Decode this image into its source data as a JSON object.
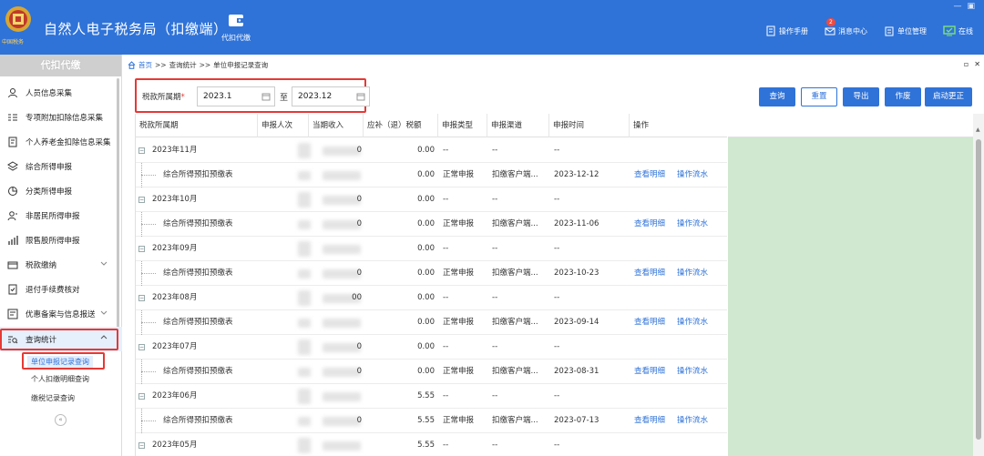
{
  "app": {
    "title": "自然人电子税务局（扣缴端）",
    "emblem_text": "中国税务",
    "module_label": "代扣代缴",
    "window_controls": [
      "—",
      "▣"
    ]
  },
  "top_right": {
    "manual": "操作手册",
    "messages": "消息中心",
    "message_count": "2",
    "unit_mgmt": "单位管理",
    "status": "在线"
  },
  "sidebar": {
    "header": "代扣代缴",
    "items": [
      {
        "label": "人员信息采集",
        "icon": "person-icon"
      },
      {
        "label": "专项附加扣除信息采集",
        "icon": "list-icon"
      },
      {
        "label": "个人养老金扣除信息采集",
        "icon": "document-icon"
      },
      {
        "label": "综合所得申报",
        "icon": "layers-icon"
      },
      {
        "label": "分类所得申报",
        "icon": "pie-icon"
      },
      {
        "label": "非居民所得申报",
        "icon": "person-outline-icon"
      },
      {
        "label": "限售股所得申报",
        "icon": "bar-chart-icon"
      },
      {
        "label": "税款缴纳",
        "icon": "wallet-icon"
      },
      {
        "label": "退付手续费核对",
        "icon": "check-doc-icon"
      },
      {
        "label": "优惠备案与信息报送",
        "icon": "report-icon"
      },
      {
        "label": "查询统计",
        "icon": "query-icon"
      }
    ],
    "sub_items": [
      "单位申报记录查询",
      "个人扣缴明细查询",
      "缴税记录查询"
    ],
    "collapse": "«"
  },
  "breadcrumb": {
    "home": "首页",
    "sep": ">>",
    "level1": "查询统计",
    "level2": "单位申报记录查询"
  },
  "filter": {
    "label": "税款所属期",
    "required_mark": "*",
    "start": "2023.1",
    "to": "至",
    "end": "2023.12"
  },
  "buttons": {
    "query": "查询",
    "reset": "重置",
    "export": "导出",
    "void": "作废",
    "correct": "启动更正"
  },
  "table": {
    "headers": [
      "税款所属期",
      "申报人次",
      "当期收入",
      "应补（退）税额",
      "申报类型",
      "申报渠道",
      "申报时间",
      "操作"
    ],
    "view_detail": "查看明细",
    "view_flow": "操作流水",
    "rows": [
      {
        "kind": "group",
        "period": "2023年11月",
        "income_tail": "0",
        "tax": "0.00",
        "type": "--",
        "channel": "--",
        "time": "--"
      },
      {
        "kind": "detail",
        "period": "综合所得预扣预缴表",
        "income_tail": "",
        "tax": "0.00",
        "type": "正常申报",
        "channel": "扣缴客户端...",
        "time": "2023-12-12"
      },
      {
        "kind": "group",
        "period": "2023年10月",
        "income_tail": "0",
        "tax": "0.00",
        "type": "--",
        "channel": "--",
        "time": "--"
      },
      {
        "kind": "detail",
        "period": "综合所得预扣预缴表",
        "income_tail": "0",
        "tax": "0.00",
        "type": "正常申报",
        "channel": "扣缴客户端...",
        "time": "2023-11-06"
      },
      {
        "kind": "group",
        "period": "2023年09月",
        "income_tail": "",
        "tax": "0.00",
        "type": "--",
        "channel": "--",
        "time": "--"
      },
      {
        "kind": "detail",
        "period": "综合所得预扣预缴表",
        "income_tail": "0",
        "tax": "0.00",
        "type": "正常申报",
        "channel": "扣缴客户端...",
        "time": "2023-10-23"
      },
      {
        "kind": "group",
        "period": "2023年08月",
        "income_tail": "00",
        "tax": "0.00",
        "type": "--",
        "channel": "--",
        "time": "--"
      },
      {
        "kind": "detail",
        "period": "综合所得预扣预缴表",
        "income_tail": "",
        "tax": "0.00",
        "type": "正常申报",
        "channel": "扣缴客户端...",
        "time": "2023-09-14"
      },
      {
        "kind": "group",
        "period": "2023年07月",
        "income_tail": "0",
        "tax": "0.00",
        "type": "--",
        "channel": "--",
        "time": "--"
      },
      {
        "kind": "detail",
        "period": "综合所得预扣预缴表",
        "income_tail": "0",
        "tax": "0.00",
        "type": "正常申报",
        "channel": "扣缴客户端...",
        "time": "2023-08-31"
      },
      {
        "kind": "group",
        "period": "2023年06月",
        "income_tail": "",
        "tax": "5.55",
        "type": "--",
        "channel": "--",
        "time": "--"
      },
      {
        "kind": "detail",
        "period": "综合所得预扣预缴表",
        "income_tail": "0",
        "tax": "5.55",
        "type": "正常申报",
        "channel": "扣缴客户端...",
        "time": "2023-07-13"
      },
      {
        "kind": "group",
        "period": "2023年05月",
        "income_tail": "",
        "tax": "5.55",
        "type": "--",
        "channel": "--",
        "time": "--"
      }
    ]
  },
  "colors": {
    "brand": "#2f73d8",
    "highlight_border": "#e53935",
    "side_panel": "#cfe8cf"
  }
}
